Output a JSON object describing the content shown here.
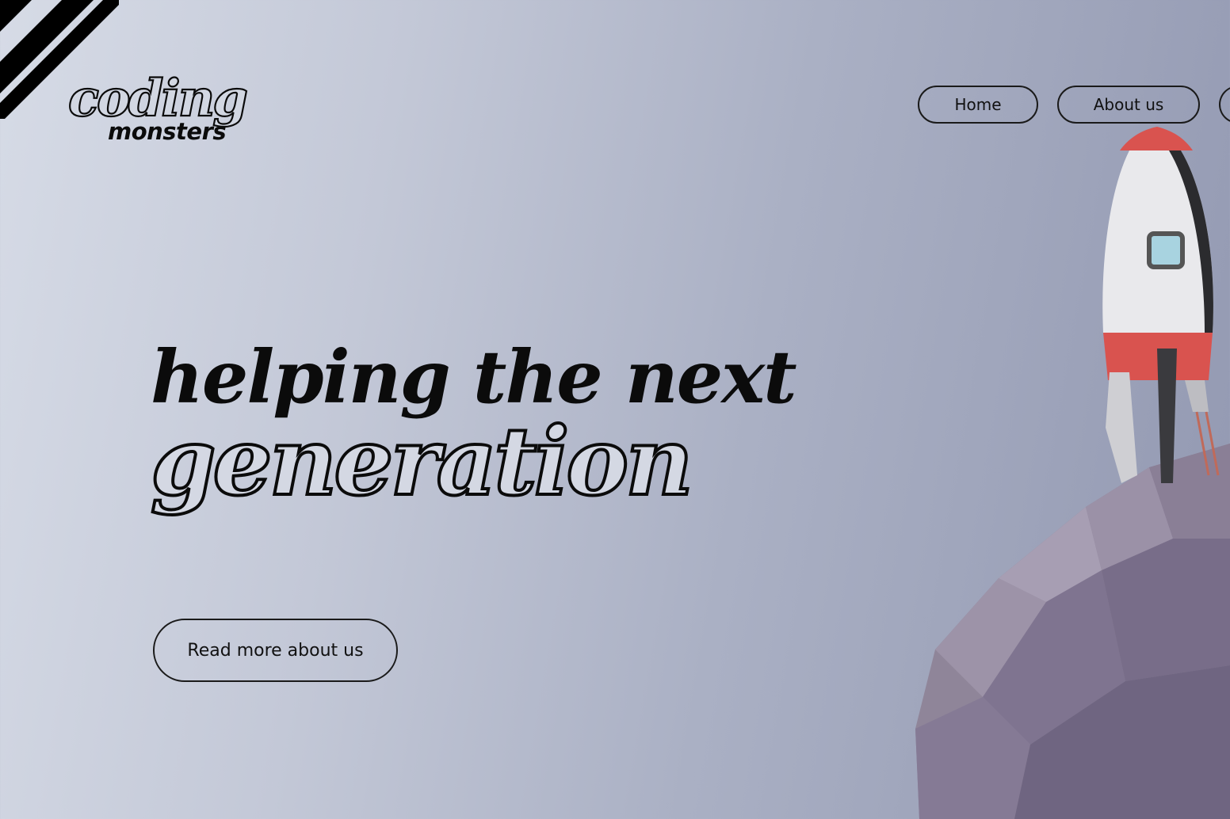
{
  "brand": {
    "logo_word_1": "coding",
    "logo_word_2": "monsters"
  },
  "nav": {
    "items": [
      {
        "label": "Home"
      },
      {
        "label": "About us"
      }
    ]
  },
  "hero": {
    "line1": "helping the next",
    "line2": "generation",
    "cta_label": "Read more about us"
  },
  "colors": {
    "background_left": "#d6dbe6",
    "background_right": "#9298b1",
    "text": "#0b0b0b",
    "rocket_red": "#d9534f",
    "rock_tan": "#c79a5a"
  },
  "icons": {
    "corner": "diagonal-stripes-decoration",
    "scene": "rocket-on-asteroid-illustration"
  }
}
